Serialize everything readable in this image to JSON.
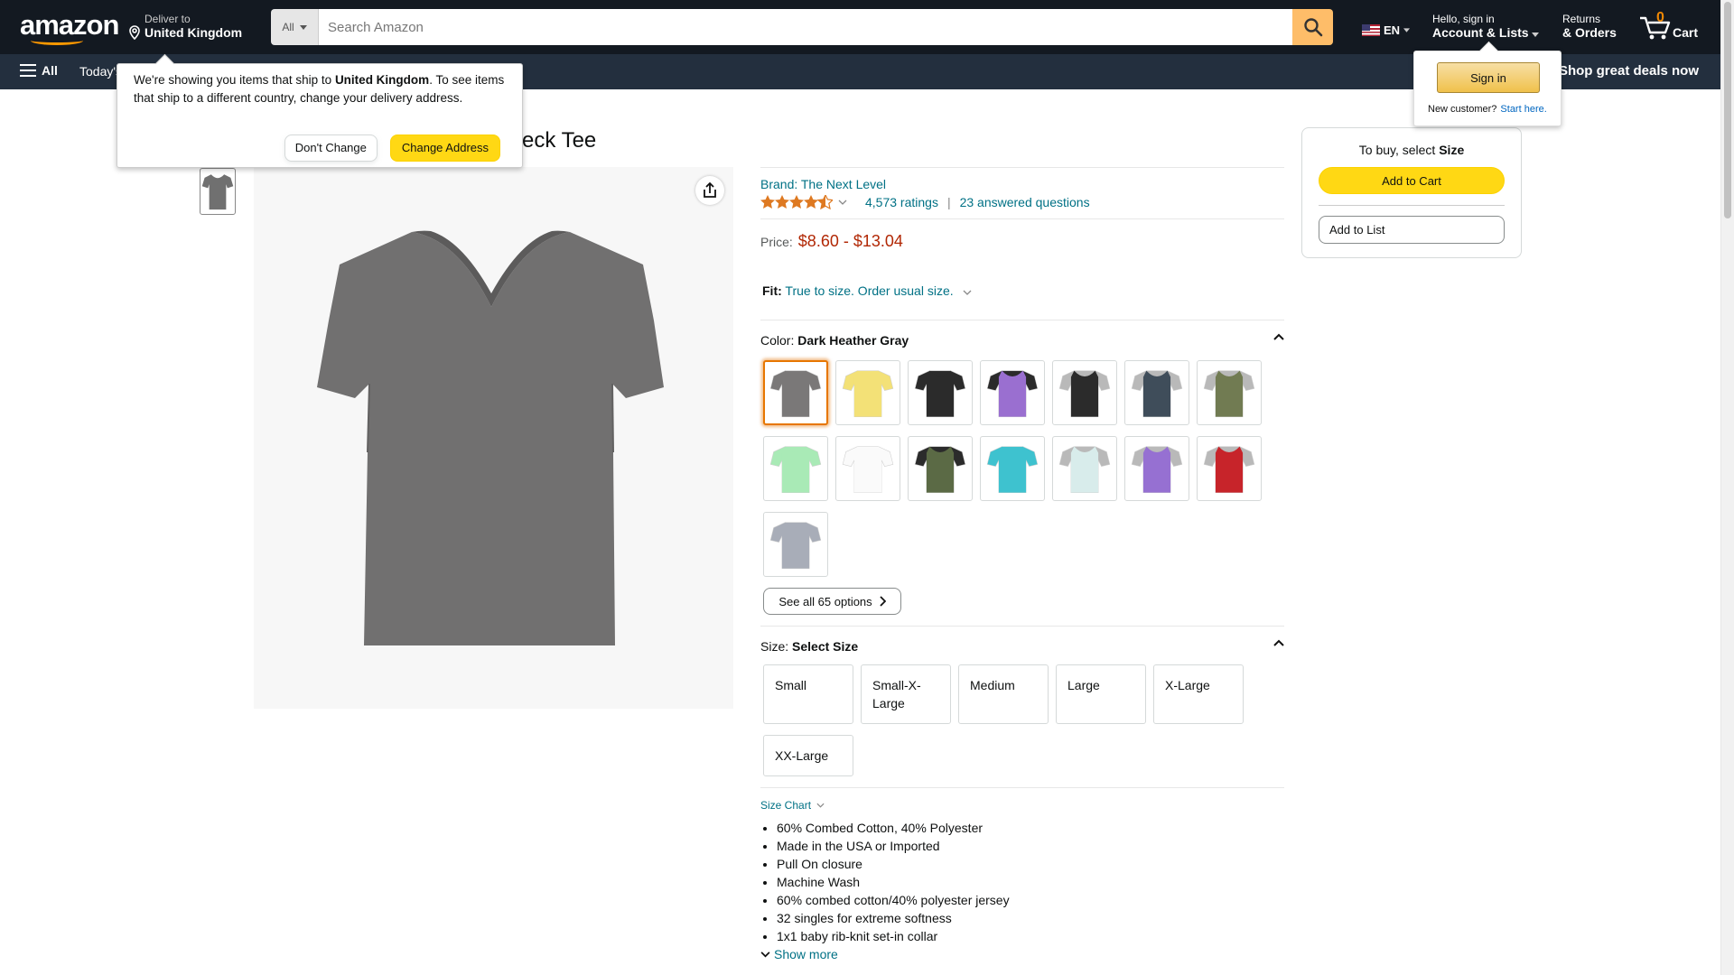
{
  "header": {
    "logo_text": "amazon",
    "deliver_line1": "Deliver to",
    "deliver_line2": "United Kingdom",
    "search_category": "All",
    "search_placeholder": "Search Amazon",
    "lang": "EN",
    "account_line1": "Hello, sign in",
    "account_line2": "Account & Lists",
    "returns_line1": "Returns",
    "returns_line2": "& Orders",
    "cart_count": "0",
    "cart_label": "Cart"
  },
  "subnav": {
    "all": "All",
    "today": "Today's",
    "deals": "Shop great deals now"
  },
  "delivery_popover": {
    "text_before": "We're showing you items that ship to ",
    "country": "United Kingdom",
    "text_after": ". To see items that ship to a different country, change your delivery address.",
    "dont_change": "Don't Change",
    "change_address": "Change Address"
  },
  "signin_popover": {
    "button": "Sign in",
    "new_customer": "New customer?",
    "start_here": "Start here."
  },
  "product": {
    "title_partial": "eck Tee",
    "brand": "Brand: The Next Level",
    "ratings": "4,573 ratings",
    "questions": "23 answered questions",
    "price_label": "Price:",
    "price": "$8.60 - $13.04",
    "fit_label": "Fit:",
    "fit_value": "True to size. Order usual size.",
    "color_label": "Color: ",
    "color_value": "Dark Heather Gray",
    "see_all": "See all 65 options",
    "size_label": "Size: ",
    "size_value": "Select Size",
    "sizes": [
      "Small",
      "Small-X-Large",
      "Medium",
      "Large",
      "X-Large",
      "XX-Large"
    ],
    "size_chart": "Size Chart",
    "bullets": [
      "60% Combed Cotton, 40% Polyester",
      "Made in the USA or Imported",
      "Pull On closure",
      "Machine Wash",
      "60% combed cotton/40% polyester jersey",
      "32 singles for extreme softness",
      "1x1 baby rib-knit set-in collar"
    ],
    "show_more": "Show more"
  },
  "swatch_colors": [
    {
      "body": "#7a7878",
      "sleeve": "#7a7878"
    },
    {
      "body": "#f3e177",
      "sleeve": "#f3e177"
    },
    {
      "body": "#2b2b2b",
      "sleeve": "#2b2b2b"
    },
    {
      "body": "#9a6fd0",
      "sleeve": "#2b2b2b"
    },
    {
      "body": "#2b2b2b",
      "sleeve": "#b9b9b9"
    },
    {
      "body": "#3f4d5a",
      "sleeve": "#b9b9b9"
    },
    {
      "body": "#717b52",
      "sleeve": "#b9b9b9"
    },
    {
      "body": "#a9eab6",
      "sleeve": "#a9eab6"
    },
    {
      "body": "#fafafa",
      "sleeve": "#fafafa"
    },
    {
      "body": "#5b6a45",
      "sleeve": "#2b2b2b"
    },
    {
      "body": "#3ec2cf",
      "sleeve": "#3ec2cf"
    },
    {
      "body": "#d8eceb",
      "sleeve": "#b9b9b9"
    },
    {
      "body": "#9670d2",
      "sleeve": "#b9b9b9"
    },
    {
      "body": "#c7242a",
      "sleeve": "#b9b9b9"
    },
    {
      "body": "#a8adb8",
      "sleeve": "#a8adb8"
    }
  ],
  "buybox": {
    "to_buy_prefix": "To buy, select ",
    "to_buy_bold": "Size",
    "add_to_cart": "Add to Cart",
    "add_to_list": "Add to List"
  },
  "colors": {
    "nav_dark": "#131921",
    "nav_sub": "#232f3e",
    "accent_yellow": "#ffd814",
    "link": "#007185",
    "price": "#b12704"
  }
}
